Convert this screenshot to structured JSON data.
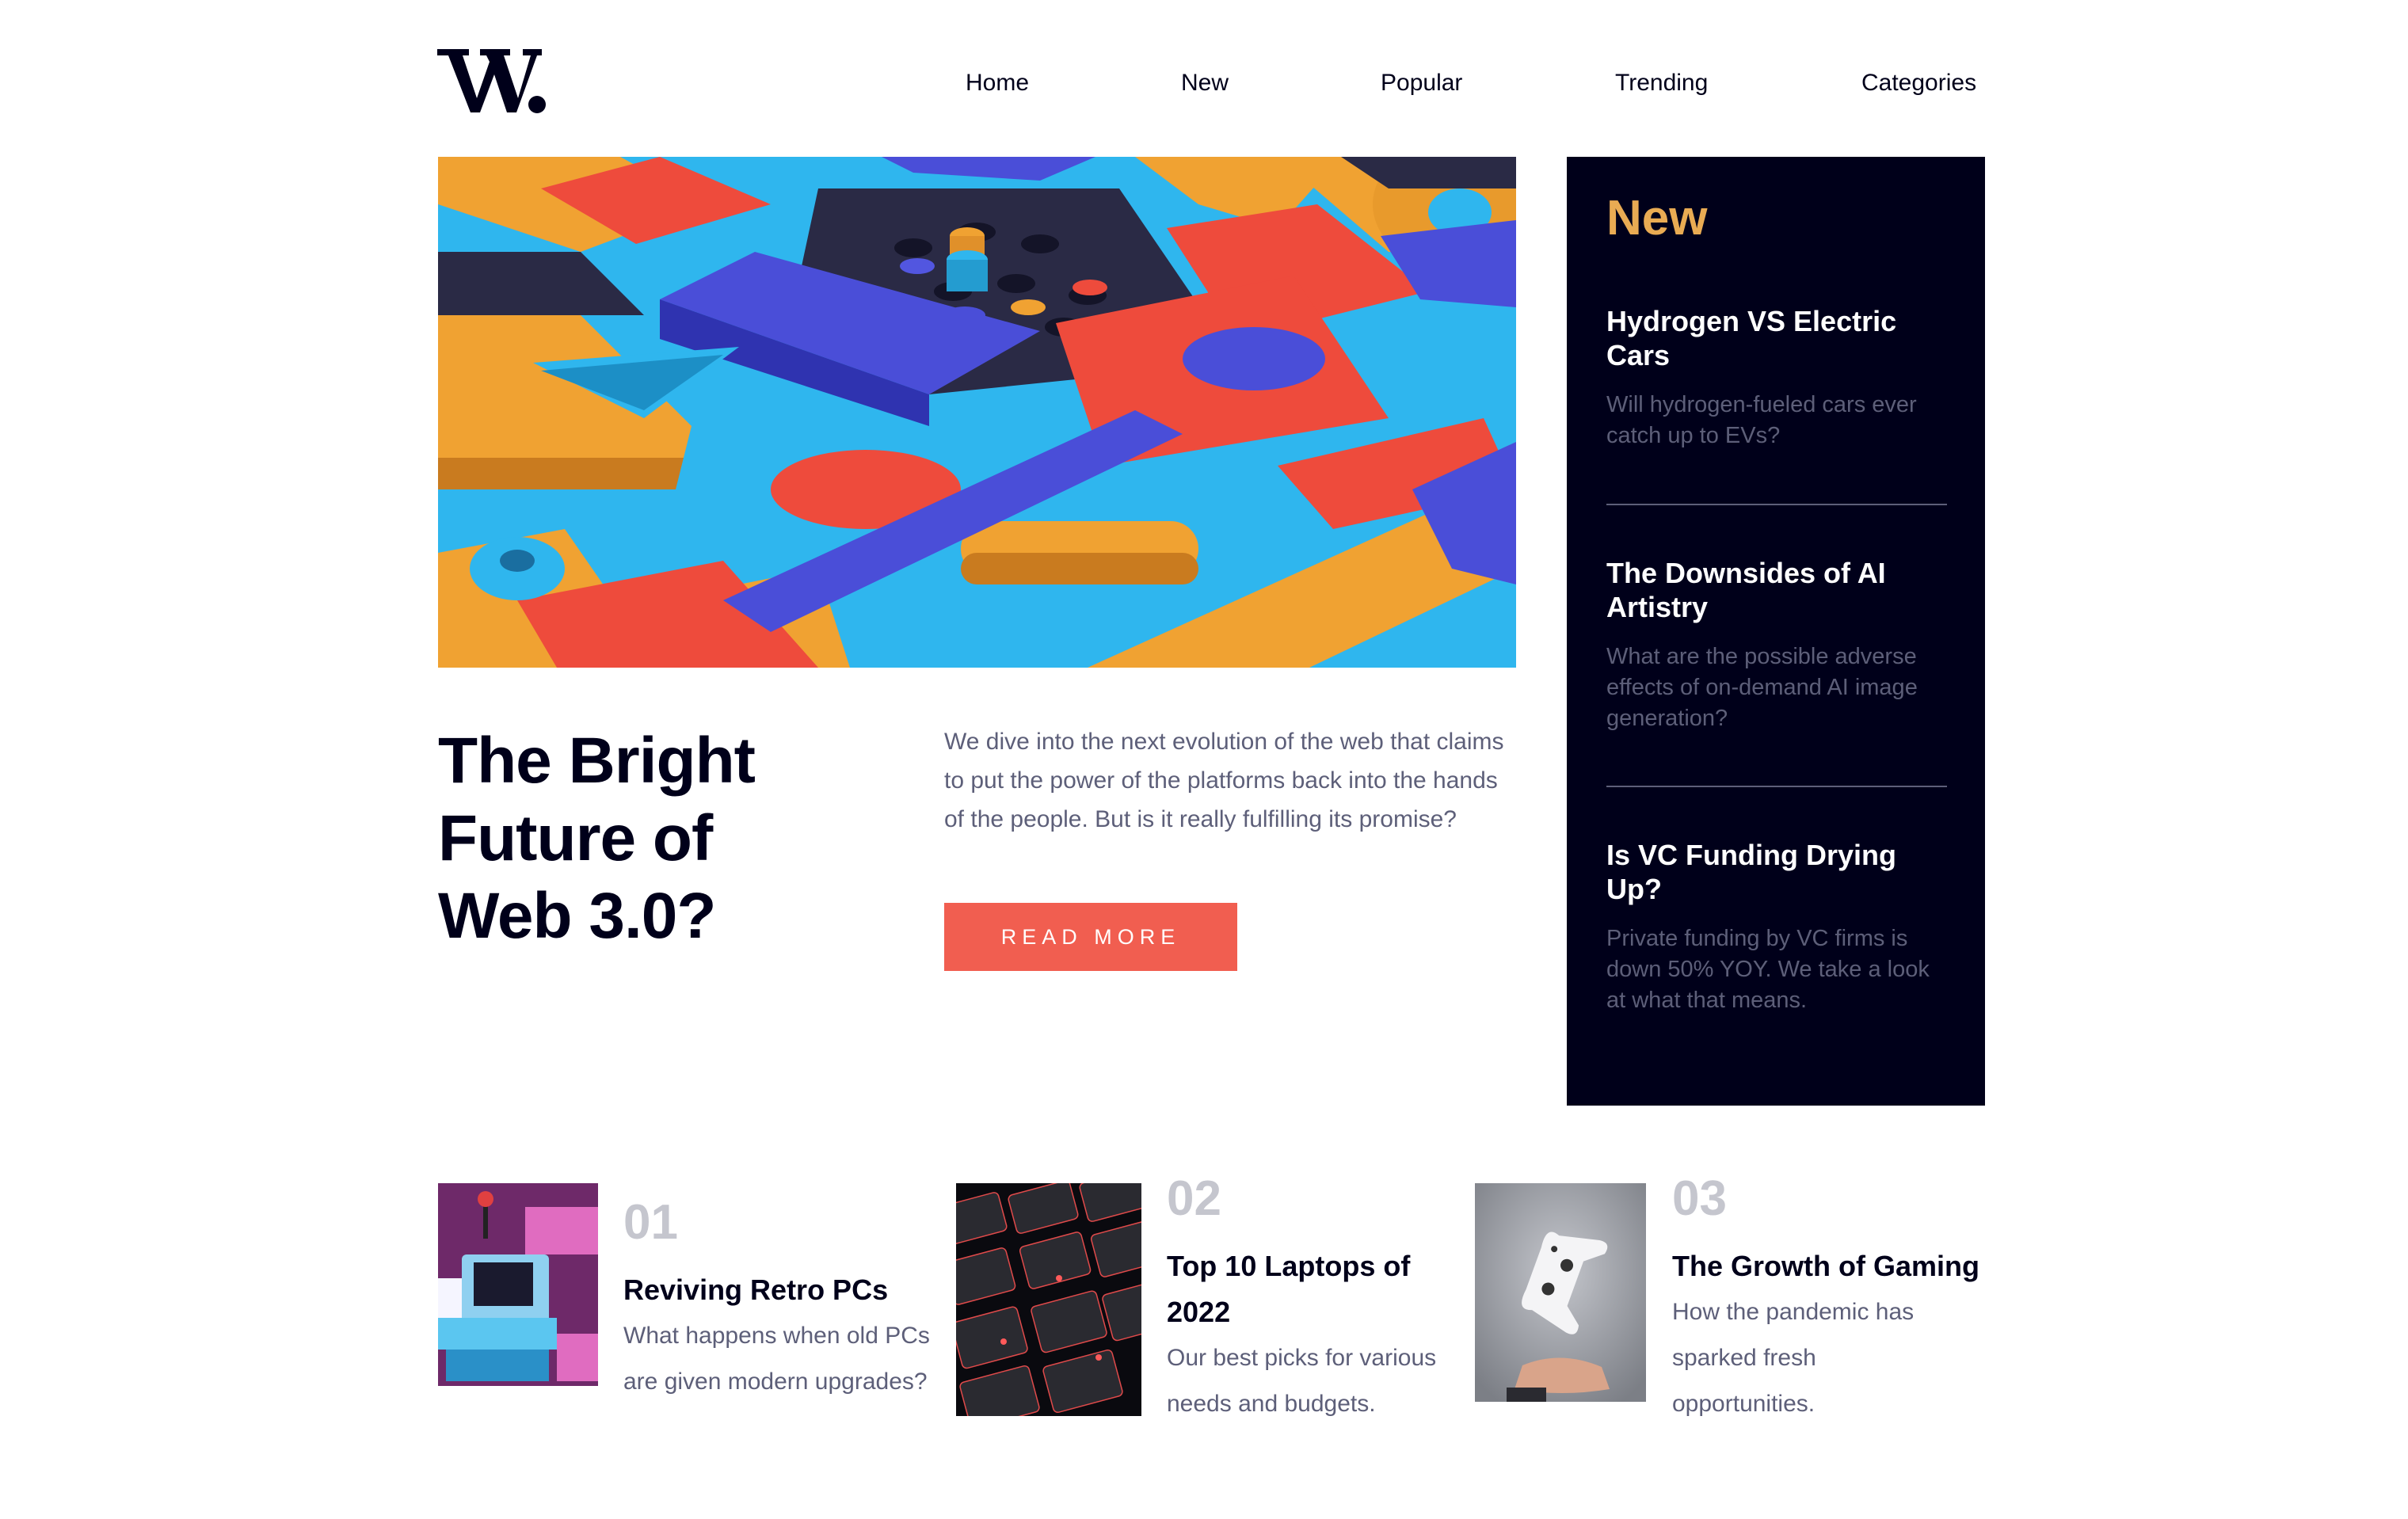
{
  "header": {
    "logo_text": "W.",
    "nav": [
      "Home",
      "New",
      "Popular",
      "Trending",
      "Categories"
    ]
  },
  "hero": {
    "title": "The Bright Future of Web 3.0?",
    "description": "We dive into the next evolution of the web that claims to put the power of the platforms back into the hands of the people. But is it really fulfilling its promise?",
    "button_label": "READ MORE"
  },
  "sidebar": {
    "heading": "New",
    "items": [
      {
        "title": "Hydrogen VS Electric Cars",
        "description": "Will hydrogen-fueled cars ever catch up to EVs?"
      },
      {
        "title": "The Downsides of AI Artistry",
        "description": "What are the possible adverse effects of on-demand AI image generation?"
      },
      {
        "title": "Is VC Funding Drying Up?",
        "description": "Private funding by VC firms is down 50% YOY. We take a look at what that means."
      }
    ]
  },
  "cards": [
    {
      "number": "01",
      "title": "Reviving Retro PCs",
      "description": "What happens when old PCs are given modern upgrades?"
    },
    {
      "number": "02",
      "title": "Top 10 Laptops of 2022",
      "description": "Our best picks for various needs and budgets."
    },
    {
      "number": "03",
      "title": "The Growth of Gaming",
      "description": "How the pandemic has sparked fresh opportunities."
    }
  ],
  "colors": {
    "dark_navy": "#00001a",
    "soft_orange": "#e9ab53",
    "soft_red": "#f15e50",
    "grayish_blue": "#5d5f79",
    "light_gray": "#c5c6ce"
  }
}
